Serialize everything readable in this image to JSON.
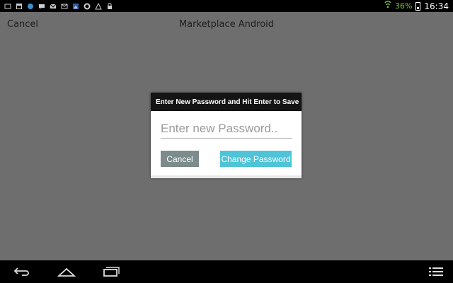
{
  "status_bar": {
    "icons": [
      "screenshot-icon",
      "calendar-icon",
      "notification-icon",
      "chat-icon",
      "gmail-icon",
      "mail-icon",
      "image-icon",
      "settings-icon",
      "warning-icon",
      "lock-icon"
    ],
    "battery_percent": "36%",
    "time": "16:34"
  },
  "app_bar": {
    "cancel_label": "Cancel",
    "title": "Marketplace Android"
  },
  "dialog": {
    "title": "Enter New Password and Hit Enter to Save",
    "input_value": "",
    "input_placeholder": "Enter new Password..",
    "cancel_label": "Cancel",
    "change_label": "Change Password"
  },
  "nav_bar": {
    "buttons": [
      "back-icon",
      "home-icon",
      "recent-apps-icon",
      "menu-icon"
    ]
  },
  "colors": {
    "dim_background": "#6e6e6e",
    "dialog_title_bg": "#141414",
    "cancel_button": "#7c8b8c",
    "change_button": "#4fc3d7",
    "battery_text": "#7bbd39"
  }
}
